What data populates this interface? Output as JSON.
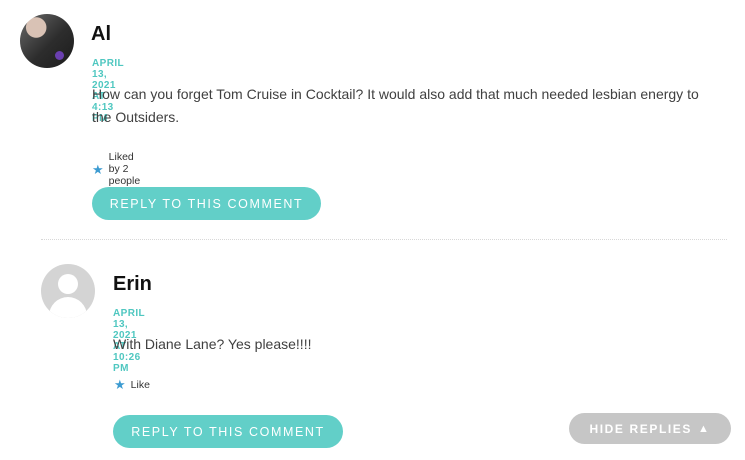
{
  "comments": [
    {
      "author": "Al",
      "date": "APRIL 13, 2021 AT 4:13 PM",
      "text_line1": "How can you forget Tom Cruise in Cocktail? It would also add that much needed lesbian energy to",
      "text_line2": "the Outsiders.",
      "like_text": "Liked by 2 people",
      "reply_label": "REPLY TO THIS COMMENT",
      "avatar_icon": "user-photo-avatar"
    },
    {
      "author": "Erin",
      "date": "APRIL 13, 2021 AT 10:26 PM",
      "text_line1": "With Diane Lane? Yes please!!!!",
      "like_text": "Like",
      "reply_label": "REPLY TO THIS COMMENT",
      "avatar_icon": "default-user-avatar"
    }
  ],
  "hide_replies": {
    "label": "HIDE REPLIES",
    "icon": "triangle-up-icon"
  },
  "colors": {
    "accent": "#62cfc8",
    "date": "#4fc7c0",
    "star": "#3c9bd1",
    "hide_button": "#c6c6c6"
  }
}
